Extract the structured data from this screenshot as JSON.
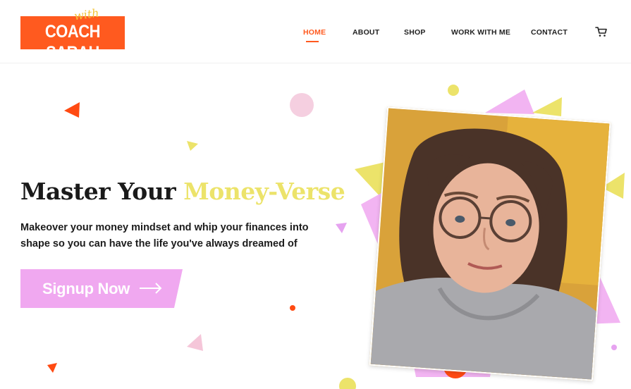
{
  "logo": {
    "name": "COACH SARAH",
    "script": "with"
  },
  "nav": {
    "items": [
      {
        "label": "HOME",
        "active": true
      },
      {
        "label": "ABOUT",
        "active": false
      },
      {
        "label": "SHOP",
        "active": false
      },
      {
        "label": "WORK WITH ME",
        "active": false
      },
      {
        "label": "CONTACT",
        "active": false
      }
    ],
    "cart_icon": "shopping-cart-icon"
  },
  "hero": {
    "headline_part1": "Master Your",
    "headline_part2": "Money-Verse",
    "subtext": "Makeover your money mindset and whip your finances into shape so you can have the life you've always dreamed of",
    "cta_label": "Signup Now",
    "cta_icon": "arrow-right-icon"
  },
  "colors": {
    "accent": "#ff5a1f",
    "pink": "#f2b4f2",
    "yellow": "#ece36a",
    "cta": "#f0a8f0"
  }
}
